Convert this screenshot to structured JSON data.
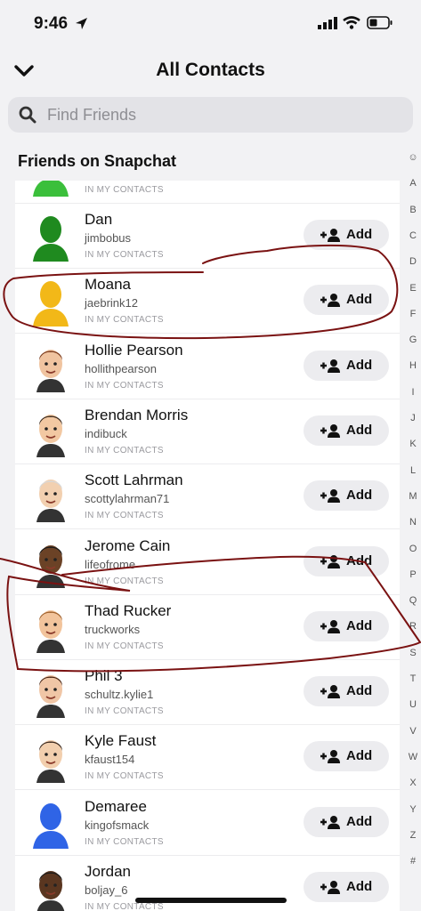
{
  "status": {
    "time": "9:46"
  },
  "header": {
    "title": "All Contacts"
  },
  "search": {
    "placeholder": "Find Friends"
  },
  "section_title": "Friends on Snapchat",
  "partial_row": {
    "sub": "IN MY CONTACTS",
    "avatar_color": "#3bbf3b"
  },
  "contacts": [
    {
      "name": "Dan",
      "username": "jimbobus",
      "sub": "IN MY CONTACTS",
      "add": "Add",
      "avatar": "silhouette",
      "color": "#1f8a1f"
    },
    {
      "name": "Moana",
      "username": "jaebrink12",
      "sub": "IN MY CONTACTS",
      "add": "Add",
      "avatar": "silhouette",
      "color": "#f2b818"
    },
    {
      "name": "Hollie  Pearson",
      "username": "hollithpearson",
      "sub": "IN MY CONTACTS",
      "add": "Add",
      "avatar": "bitmoji",
      "skin": "#f0c4a0",
      "hair": "#7a3a1c"
    },
    {
      "name": "Brendan Morris",
      "username": "indibuck",
      "sub": "IN MY CONTACTS",
      "add": "Add",
      "avatar": "bitmoji",
      "skin": "#f2c8a2",
      "hair": "#3a2a1e"
    },
    {
      "name": "Scott  Lahrman",
      "username": "scottylahrman71",
      "sub": "IN MY CONTACTS",
      "add": "Add",
      "avatar": "bitmoji",
      "skin": "#f2d0b0",
      "hair": "#d8d8d8"
    },
    {
      "name": "Jerome Cain",
      "username": "lifeofrome",
      "sub": "IN MY CONTACTS",
      "add": "Add",
      "avatar": "bitmoji",
      "skin": "#6b4226",
      "hair": "#1a1a1a"
    },
    {
      "name": "Thad  Rucker",
      "username": "truckworks",
      "sub": "IN MY CONTACTS",
      "add": "Add",
      "avatar": "bitmoji",
      "skin": "#f2c49c",
      "hair": "#a0622e"
    },
    {
      "name": "Phil 3",
      "username": "schultz.kylie1",
      "sub": "IN MY CONTACTS",
      "add": "Add",
      "avatar": "bitmoji",
      "skin": "#f0c6a6",
      "hair": "#4a2716"
    },
    {
      "name": "Kyle  Faust",
      "username": "kfaust154",
      "sub": "IN MY CONTACTS",
      "add": "Add",
      "avatar": "bitmoji",
      "skin": "#f2cfae",
      "hair": "#3b2a20"
    },
    {
      "name": "Demaree",
      "username": "kingofsmack",
      "sub": "IN MY CONTACTS",
      "add": "Add",
      "avatar": "silhouette",
      "color": "#2f64e6"
    },
    {
      "name": "Jordan",
      "username": "boljay_6",
      "sub": "IN MY CONTACTS",
      "add": "Add",
      "avatar": "bitmoji",
      "skin": "#5a3620",
      "hair": "#1a1a1a"
    }
  ],
  "alphabet": [
    "☺",
    "A",
    "B",
    "C",
    "D",
    "E",
    "F",
    "G",
    "H",
    "I",
    "J",
    "K",
    "L",
    "M",
    "N",
    "O",
    "P",
    "Q",
    "R",
    "S",
    "T",
    "U",
    "V",
    "W",
    "X",
    "Y",
    "Z",
    "#"
  ],
  "colors": {
    "ink": "#7a1212",
    "button_bg": "#ececef",
    "search_bg": "#e3e3e7"
  }
}
